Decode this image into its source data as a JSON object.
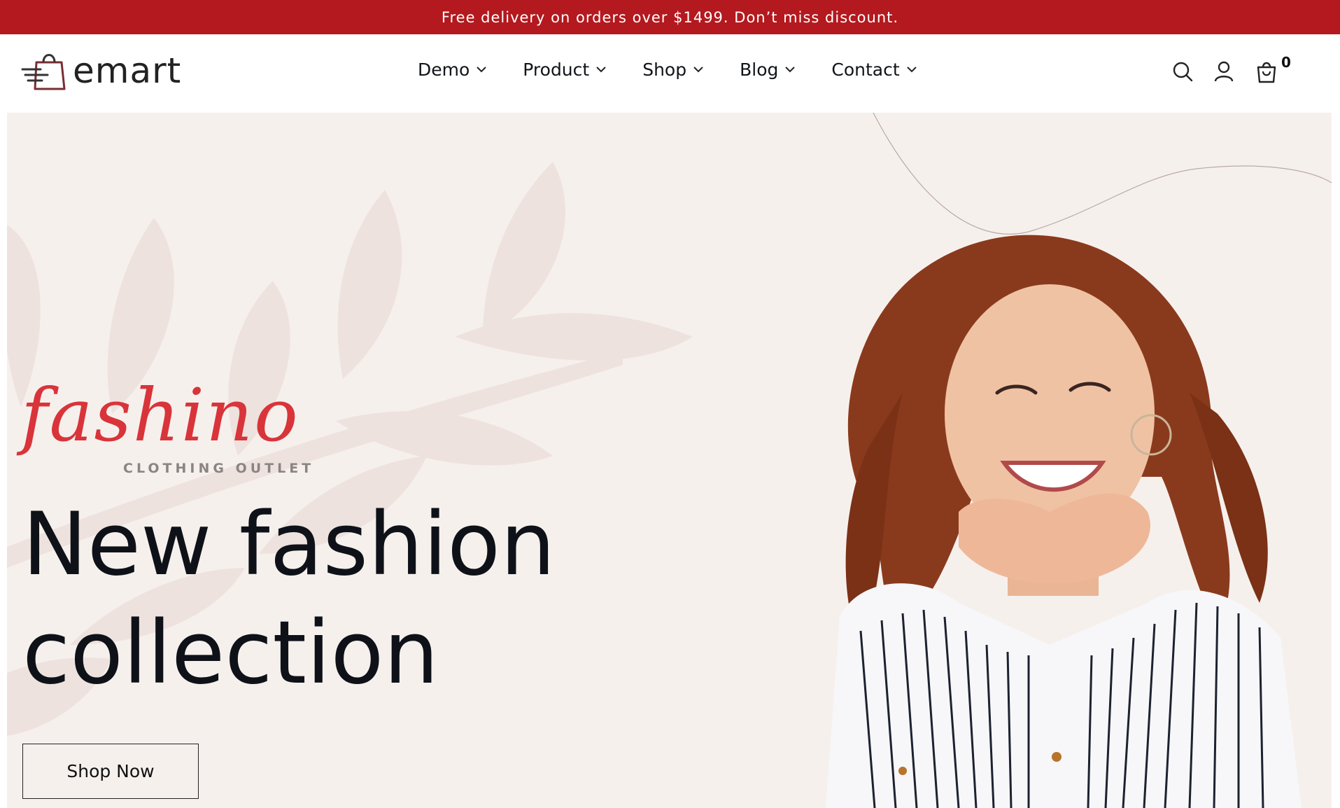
{
  "promo": {
    "text": "Free delivery on orders over $1499. Don’t miss discount."
  },
  "header": {
    "logo_text": "emart",
    "nav": [
      {
        "label": "Demo"
      },
      {
        "label": "Product"
      },
      {
        "label": "Shop"
      },
      {
        "label": "Blog"
      },
      {
        "label": "Contact"
      }
    ],
    "icons": [
      "search-icon",
      "user-icon",
      "cart-icon"
    ],
    "cart_count": "0"
  },
  "hero": {
    "brand_script": "fashino",
    "brand_sub": "CLOTHING OUTLET",
    "title_line1": "New fashion",
    "title_line2": "collection",
    "cta_label": "Shop Now"
  },
  "colors": {
    "promo_bg": "#b3191e",
    "hero_bg": "#f6f0ed",
    "brand_script": "#d8343a",
    "text_dark": "#0e1218"
  }
}
